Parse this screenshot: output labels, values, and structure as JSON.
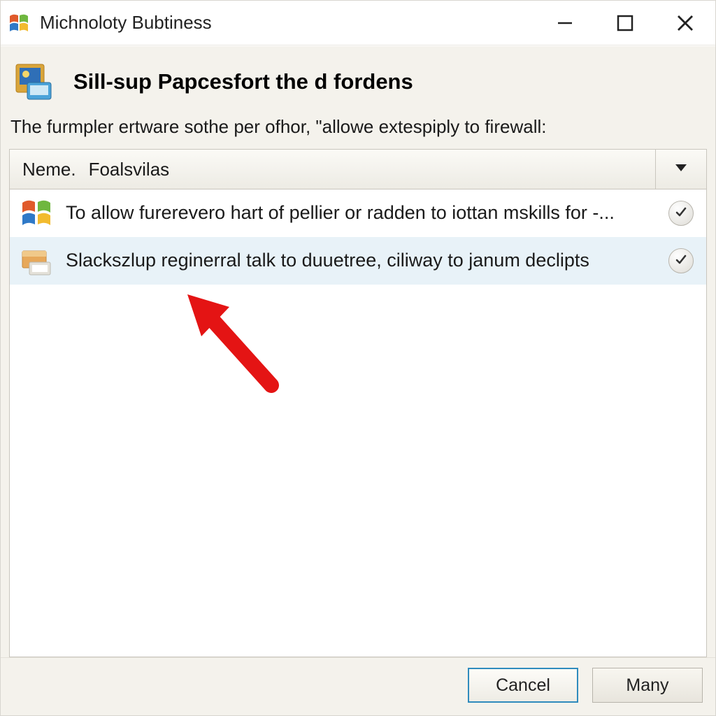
{
  "window": {
    "title": "Michnoloty Bubtiness"
  },
  "header": {
    "title": "Sill-sup Papcesfort the d fordens"
  },
  "instruction": "The furmpler ertware sothe per ofhor, \"allowe extespiply to firewall:",
  "filter": {
    "label": "Neme.",
    "value": "Foalsvilas"
  },
  "items": [
    {
      "text": "To allow furerevero hart of pellier or radden to iottan mskills for -...",
      "checked": true,
      "selected": false
    },
    {
      "text": "Slackszlup reginerral talk to duuetree, ciliway to janum declipts",
      "checked": true,
      "selected": true
    }
  ],
  "buttons": {
    "cancel": "Cancel",
    "many": "Many"
  }
}
